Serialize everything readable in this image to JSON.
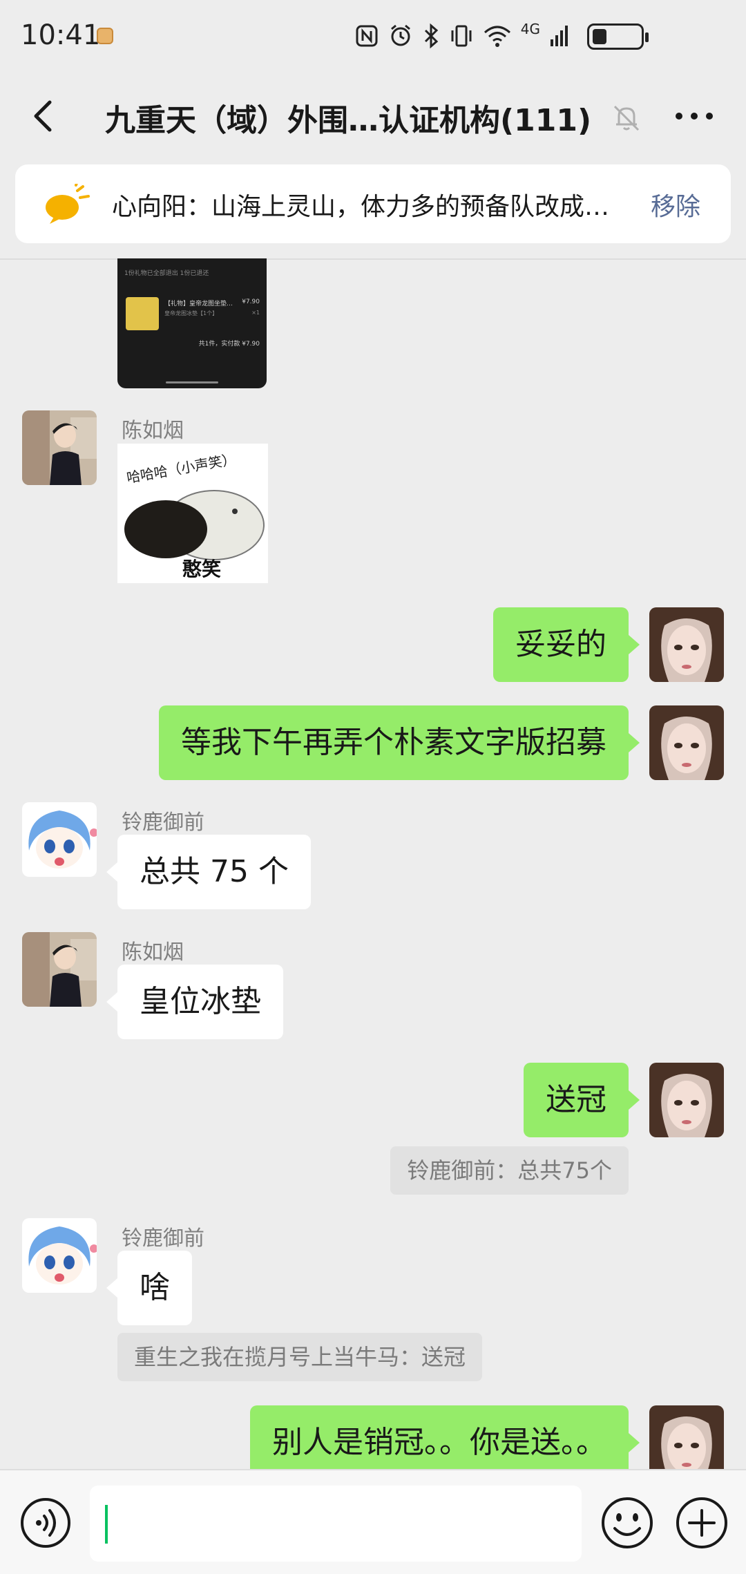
{
  "status_bar": {
    "time": "10:41",
    "icons": [
      "nfc-icon",
      "alarm-icon",
      "bluetooth-icon",
      "vibrate-icon",
      "wifi-icon",
      "signal-4g-icon",
      "battery-icon"
    ],
    "network_label": "4G",
    "battery_level": 0.3
  },
  "header": {
    "title": "九重天（域）外围…认证机构(111)"
  },
  "pinned": {
    "text": "心向阳：山海上灵山，体力多的预备队改成…",
    "remove_label": "移除"
  },
  "messages": [
    {
      "type": "image",
      "direction": "in",
      "description_icon": "screenshot-image"
    },
    {
      "type": "sticker",
      "direction": "in",
      "sender": "陈如烟",
      "sticker_top_text": "哈哈哈（小声笑）",
      "sticker_bottom_text": "憨笑"
    },
    {
      "type": "text",
      "direction": "out",
      "text": "妥妥的"
    },
    {
      "type": "text",
      "direction": "out",
      "text": "等我下午再弄个朴素文字版招募"
    },
    {
      "type": "text",
      "direction": "in",
      "sender": "铃鹿御前",
      "text": "总共 75 个"
    },
    {
      "type": "text",
      "direction": "in",
      "sender": "陈如烟",
      "text": "皇位冰垫"
    },
    {
      "type": "text",
      "direction": "out",
      "text": "送冠",
      "quote": "铃鹿御前：总共75个"
    },
    {
      "type": "text",
      "direction": "in",
      "sender": "铃鹿御前",
      "text": "啥",
      "quote": "重生之我在揽月号上当牛马：送冠"
    },
    {
      "type": "text",
      "direction": "out",
      "text": "别人是销冠。。你是送。。"
    }
  ],
  "screenshot_image": {
    "line1": "1份礼物已全部退出  1份已退还",
    "item_title": "【礼物】皇帝龙图坐垫…",
    "item_sub": "皇帝龙图冰垫【1个】",
    "item_price": "¥7.90",
    "item_qty": "×1",
    "total": "共1件，实付款 ¥7.90"
  },
  "input_bar": {
    "value": "",
    "icons": [
      "voice-icon",
      "emoji-icon",
      "plus-icon"
    ]
  },
  "colors": {
    "outgoing_bubble": "#95ec69",
    "incoming_bubble": "#ffffff",
    "link": "#576b95",
    "cursor": "#07c160",
    "background": "#ededed"
  }
}
